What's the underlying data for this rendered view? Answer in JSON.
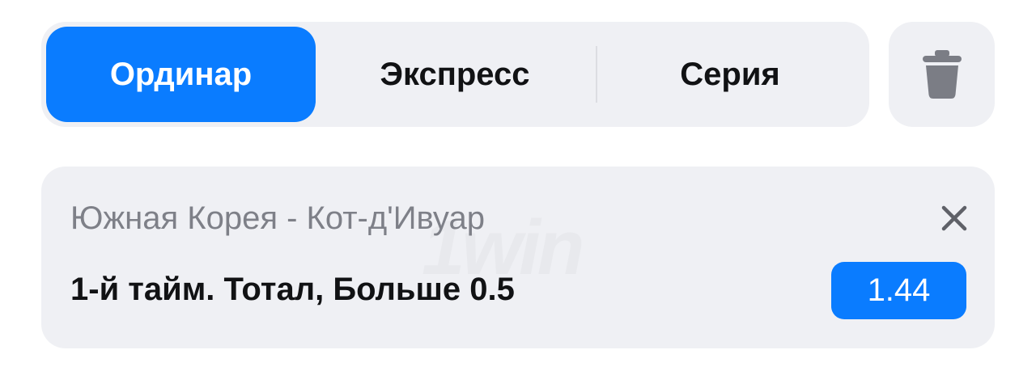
{
  "bet_type_tabs": [
    {
      "label": "Ординар",
      "active": true
    },
    {
      "label": "Экспресс",
      "active": false
    },
    {
      "label": "Серия",
      "active": false
    }
  ],
  "icons": {
    "clear": "trash-icon",
    "remove": "close-icon"
  },
  "bet": {
    "match": "Южная Корея - Кот-д'Ивуар",
    "market": "1-й тайм. Тотал, Больше 0.5",
    "odds": "1.44"
  },
  "brand": {
    "watermark": "1win"
  },
  "colors": {
    "accent": "#0a7cff",
    "surface": "#eff0f4",
    "text_primary": "#111214",
    "text_secondary": "#7e8088",
    "icon": "#7b7d85"
  }
}
